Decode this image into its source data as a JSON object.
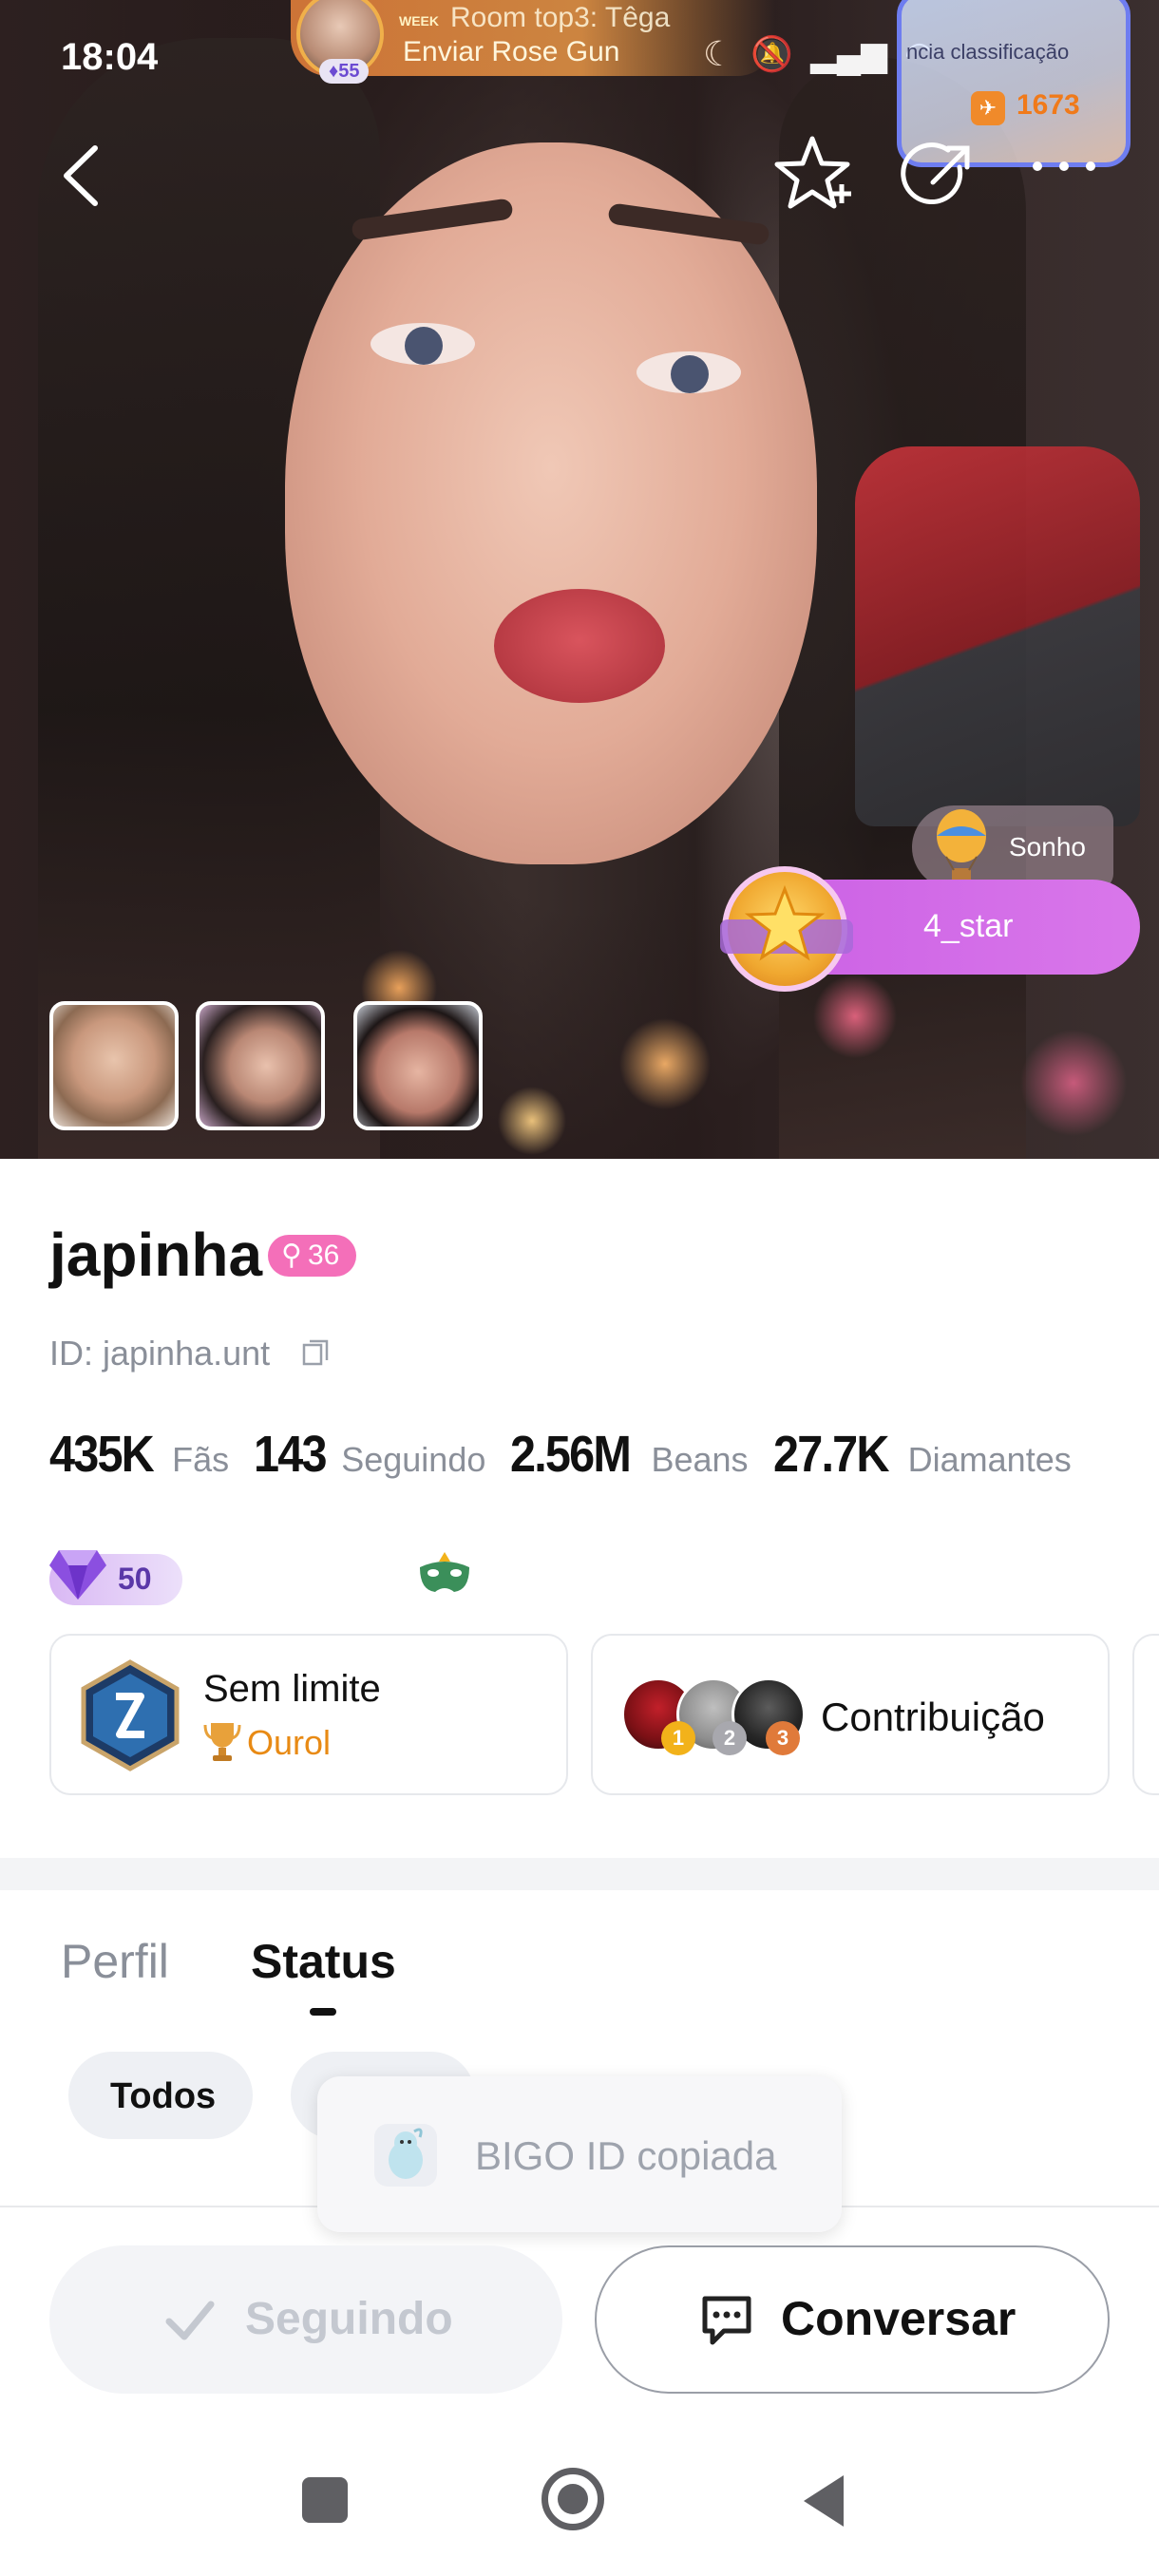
{
  "status_bar": {
    "time": "18:04",
    "icons": [
      "moon-icon",
      "bell-off-icon",
      "x1-icon",
      "signal-icon",
      "wifi-icon",
      "battery-icon"
    ]
  },
  "room_banner": {
    "level": "55",
    "week_tag": "WEEK",
    "line1": "Room top3: Têga",
    "line2": "Enviar Rose Gun"
  },
  "rank_card": {
    "text": "ncia   classificação",
    "value": "1673"
  },
  "overlay": {
    "sonho_label": "Sonho",
    "star_label": "4_star"
  },
  "profile": {
    "name": "japinha",
    "level": "36",
    "id_text": "ID: japinha.unt",
    "stats": [
      {
        "value": "435K",
        "label": "Fãs"
      },
      {
        "value": "143",
        "label": "Seguindo"
      },
      {
        "value": "2.56M",
        "label": "Beans"
      },
      {
        "value": "27.7K",
        "label": "Diamantes"
      }
    ],
    "gem_value": "50"
  },
  "cards": {
    "sem_limite_title": "Sem limite",
    "sem_limite_sub": "Ourol",
    "contrib_label": "Contribuição",
    "contrib_ranks": [
      "1",
      "2",
      "3"
    ]
  },
  "tabs": {
    "perfil": "Perfil",
    "status": "Status"
  },
  "chips": {
    "todos": "Todos"
  },
  "toast": {
    "text": "BIGO ID copiada"
  },
  "buttons": {
    "following": "Seguindo",
    "chat": "Conversar"
  },
  "colors": {
    "level_pill": "#f46fb9",
    "star_badge": "#cc62e5",
    "gold_text": "#e88a14"
  }
}
